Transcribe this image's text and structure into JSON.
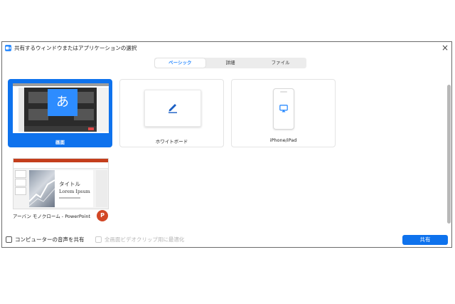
{
  "window": {
    "title": "共有するウィンドウまたはアプリケーションの選択",
    "close_glyph": "×"
  },
  "tabs": [
    {
      "label": "ベーシック",
      "active": true
    },
    {
      "label": "詳細",
      "active": false
    },
    {
      "label": "ファイル",
      "active": false
    }
  ],
  "items": [
    {
      "label": "画面",
      "thumb_char": "あ",
      "selected": true
    },
    {
      "label": "ホワイトボード",
      "selected": false
    },
    {
      "label": "iPhone/iPad",
      "selected": false
    },
    {
      "label": "アーバン モノクローム - PowerPoint",
      "selected": false,
      "slide_title": "タイトル",
      "slide_subtitle": "Lorem Ipsum",
      "badge": "P"
    }
  ],
  "footer": {
    "share_audio_label": "コンピューターの音声を共有",
    "optimize_label": "全画面ビデオクリップ用に最適化",
    "share_button": "共有"
  },
  "colors": {
    "accent": "#0e72ed",
    "powerpoint": "#d24726"
  }
}
